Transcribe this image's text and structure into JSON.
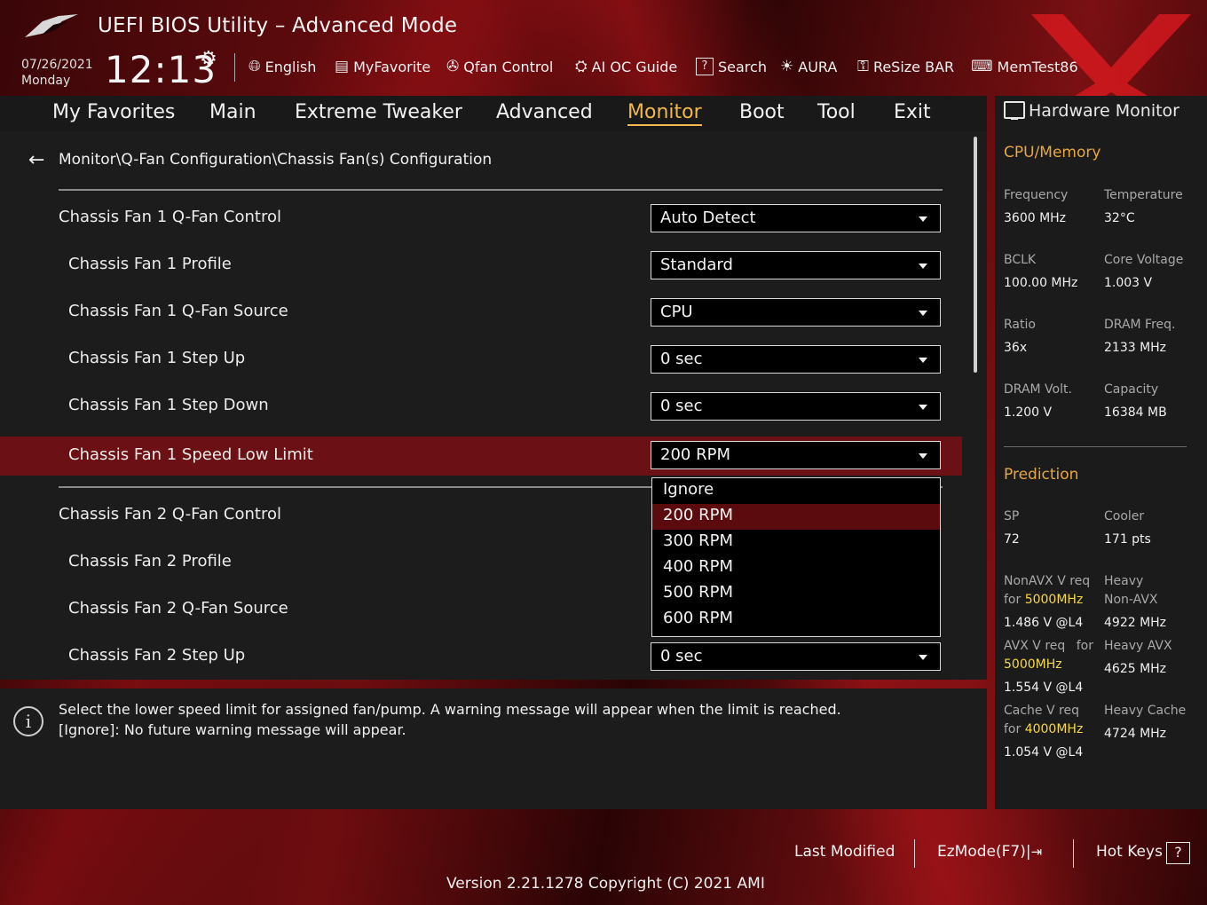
{
  "header": {
    "title": "UEFI BIOS Utility – Advanced Mode",
    "date": "07/26/2021",
    "day": "Monday",
    "time": "12:13",
    "tools": [
      {
        "icon": "globe-icon",
        "label": "English"
      },
      {
        "icon": "favorite-list-icon",
        "label": "MyFavorite"
      },
      {
        "icon": "fan-icon",
        "label": "Qfan Control"
      },
      {
        "icon": "ai-chip-icon",
        "label": "AI OC Guide"
      },
      {
        "icon": "question-box-icon",
        "label": "Search"
      },
      {
        "icon": "aura-light-icon",
        "label": "AURA"
      },
      {
        "icon": "resize-bar-icon",
        "label": "ReSize BAR"
      },
      {
        "icon": "memory-icon",
        "label": "MemTest86"
      }
    ]
  },
  "nav": {
    "tabs": [
      "My Favorites",
      "Main",
      "Extreme Tweaker",
      "Advanced",
      "Monitor",
      "Boot",
      "Tool",
      "Exit"
    ],
    "active": "Monitor"
  },
  "main": {
    "breadcrumb": "Monitor\\Q-Fan Configuration\\Chassis Fan(s) Configuration",
    "rows": [
      {
        "label": "Chassis Fan 1 Q-Fan Control",
        "value": "Auto Detect"
      },
      {
        "label": "Chassis Fan 1 Profile",
        "value": "Standard"
      },
      {
        "label": "Chassis Fan 1 Q-Fan Source",
        "value": "CPU"
      },
      {
        "label": "Chassis Fan 1 Step Up",
        "value": "0 sec"
      },
      {
        "label": "Chassis Fan 1 Step Down",
        "value": "0 sec"
      },
      {
        "label": "Chassis Fan 1 Speed Low Limit",
        "value": "200 RPM"
      },
      {
        "label": "Chassis Fan 2 Q-Fan Control",
        "value": ""
      },
      {
        "label": "Chassis Fan 2 Profile",
        "value": ""
      },
      {
        "label": "Chassis Fan 2 Q-Fan Source",
        "value": ""
      },
      {
        "label": "Chassis Fan 2 Step Up",
        "value": "0 sec"
      }
    ],
    "dropdown_options": [
      "Ignore",
      "200 RPM",
      "300 RPM",
      "400 RPM",
      "500 RPM",
      "600 RPM"
    ],
    "dropdown_selected": "200 RPM"
  },
  "info": {
    "line1": "Select the lower speed limit for assigned fan/pump. A warning message will appear when the limit is reached.",
    "line2": "[Ignore]: No future warning message will appear."
  },
  "hw_monitor": {
    "title": "Hardware Monitor",
    "cpu_mem_heading": "CPU/Memory",
    "frequency_label": "Frequency",
    "frequency": "3600 MHz",
    "temperature_label": "Temperature",
    "temperature": "32°C",
    "bclk_label": "BCLK",
    "bclk": "100.00 MHz",
    "core_voltage_label": "Core Voltage",
    "core_voltage": "1.003 V",
    "ratio_label": "Ratio",
    "ratio": "36x",
    "dram_freq_label": "DRAM Freq.",
    "dram_freq": "2133 MHz",
    "dram_volt_label": "DRAM Volt.",
    "dram_volt": "1.200 V",
    "capacity_label": "Capacity",
    "capacity": "16384 MB",
    "prediction_heading": "Prediction",
    "sp_label": "SP",
    "sp": "72",
    "cooler_label": "Cooler",
    "cooler": "171 pts",
    "nonavx_req_label": "NonAVX V req",
    "for": "for",
    "nonavx_freq": "5000MHz",
    "nonavx_v": "1.486 V @L4",
    "heavy_label": "Heavy",
    "nonavx_label": "Non-AVX",
    "heavy_nonavx": "4922 MHz",
    "avx_req_label": "AVX V req",
    "avx_freq": "5000MHz",
    "avx_v": "1.554 V @L4",
    "heavy_avx_label": "Heavy AVX",
    "heavy_avx": "4625 MHz",
    "cache_req_label": "Cache V req",
    "cache_freq": "4000MHz",
    "cache_v": "1.054 V @L4",
    "heavy_cache_label": "Heavy Cache",
    "heavy_cache": "4724 MHz"
  },
  "footer": {
    "last_modified": "Last Modified",
    "ezmode": "EzMode(F7)|",
    "hot_keys": "Hot Keys",
    "hot_keys_icon": "?",
    "version": "Version 2.21.1278 Copyright (C) 2021 AMI"
  },
  "colors": {
    "accent": "#f2b84b",
    "selected_row": "#6b1014",
    "hw_heading": "#e8a640",
    "highlight_freq": "#f5d94a"
  }
}
